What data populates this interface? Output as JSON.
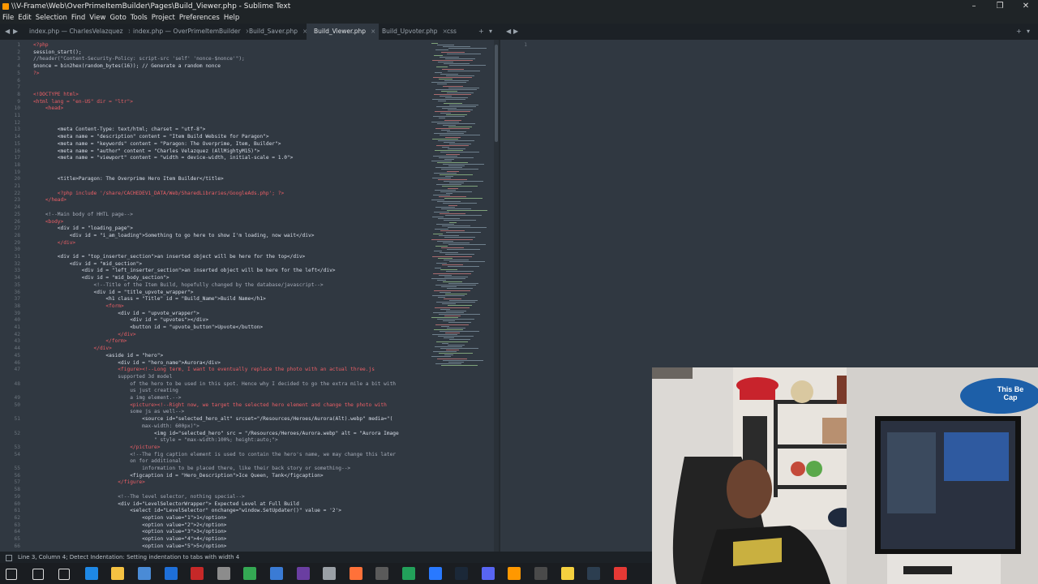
{
  "window": {
    "title": "\\\\V-Frame\\Web\\OverPrimeItemBuilder\\Pages\\Build_Viewer.php - Sublime Text",
    "min": "–",
    "max": "❐",
    "close": "✕"
  },
  "menu": [
    "File",
    "Edit",
    "Selection",
    "Find",
    "View",
    "Goto",
    "Tools",
    "Project",
    "Preferences",
    "Help"
  ],
  "tabs": [
    {
      "label": "index.php — CharlesVelazquez",
      "active": false
    },
    {
      "label": "index.php — OverPrimeItemBuilder",
      "active": false
    },
    {
      "label": "Build_Saver.php",
      "active": false
    },
    {
      "label": "Build_Viewer.php",
      "active": true
    },
    {
      "label": "Build_Upvoter.php",
      "active": false
    },
    {
      "label": "css",
      "active": false
    }
  ],
  "tab_close": "×",
  "nav": {
    "back": "◀",
    "fwd": "▶",
    "add": "+",
    "more": "▾",
    "plus_right": "+",
    "menu_right": "▾"
  },
  "code_lines": [
    {
      "n": "1",
      "t": "<?php"
    },
    {
      "n": "2",
      "t": "session_start();"
    },
    {
      "n": "3",
      "t": "//header(\"Content-Security-Policy: script-src 'self' 'nonce-$nonce'\");"
    },
    {
      "n": "4",
      "t": "$nonce = bin2hex(random_bytes(16)); // Generate a random nonce"
    },
    {
      "n": "5",
      "t": "?>"
    },
    {
      "n": "6",
      "t": ""
    },
    {
      "n": "7",
      "t": ""
    },
    {
      "n": "8",
      "t": "<!DOCTYPE html>"
    },
    {
      "n": "9",
      "t": "<html lang = \"en-US\" dir = \"ltr\">"
    },
    {
      "n": "10",
      "t": "    <head>"
    },
    {
      "n": "11",
      "t": ""
    },
    {
      "n": "12",
      "t": ""
    },
    {
      "n": "13",
      "t": "        <meta Content-Type: text/html; charset = \"utf-8\">"
    },
    {
      "n": "14",
      "t": "        <meta name = \"description\" content = \"Item Build Website for Paragon\">"
    },
    {
      "n": "15",
      "t": "        <meta name = \"keywords\" content = \"Paragon: The Overprime, Item, Builder\">"
    },
    {
      "n": "16",
      "t": "        <meta name = \"author\" content = \"Charles Velazquez (AllMightyM15)\">"
    },
    {
      "n": "17",
      "t": "        <meta name = \"viewport\" content = \"width = device-width, initial-scale = 1.0\">"
    },
    {
      "n": "18",
      "t": ""
    },
    {
      "n": "19",
      "t": ""
    },
    {
      "n": "20",
      "t": "        <title>Paragon: The Overprime Hero Item Builder</title>"
    },
    {
      "n": "21",
      "t": ""
    },
    {
      "n": "22",
      "t": "        <?php include '/share/CACHEDEV1_DATA/Web/SharedLibraries/GoogleAds.php'; ?>"
    },
    {
      "n": "23",
      "t": "    </head>"
    },
    {
      "n": "24",
      "t": ""
    },
    {
      "n": "25",
      "t": "    <!--Main body of HHTL page-->"
    },
    {
      "n": "26",
      "t": "    <body>"
    },
    {
      "n": "27",
      "t": "        <div id = \"loading_page\">"
    },
    {
      "n": "28",
      "t": "            <div id = \"i_am_loading\">Something to go here to show I'm loading, now wait</div>"
    },
    {
      "n": "29",
      "t": "        </div>"
    },
    {
      "n": "30",
      "t": ""
    },
    {
      "n": "31",
      "t": "        <div id = \"top_inserter_section\">an inserted object will be here for the top</div>"
    },
    {
      "n": "32",
      "t": "            <div id = \"mid_section\">"
    },
    {
      "n": "33",
      "t": "                <div id = \"left_inserter_section\">an inserted object will be here for the left</div>"
    },
    {
      "n": "34",
      "t": "                <div id = \"mid_body_section\">"
    },
    {
      "n": "35",
      "t": "                    <!--Title of the Item Build, hopefully changed by the database/javascript-->"
    },
    {
      "n": "36",
      "t": "                    <div id = \"title_upvote_wrapper\">"
    },
    {
      "n": "37",
      "t": "                        <h1 class = \"Title\" id = \"Build_Name\">Build Name</h1>"
    },
    {
      "n": "38",
      "t": "                        <form>"
    },
    {
      "n": "39",
      "t": "                            <div id = \"upvote_wrapper\">"
    },
    {
      "n": "40",
      "t": "                                <div id = \"upvotes\"></div>"
    },
    {
      "n": "41",
      "t": "                                <button id = \"upvote_button\">Upvote</button>"
    },
    {
      "n": "42",
      "t": "                            </div>"
    },
    {
      "n": "43",
      "t": "                        </form>"
    },
    {
      "n": "44",
      "t": "                    </div>"
    },
    {
      "n": "45",
      "t": "                        <aside id = \"hero\">"
    },
    {
      "n": "46",
      "t": "                            <div id = \"hero_name\">Aurora</div>"
    },
    {
      "n": "47",
      "t": "                            <figure><!--Long term, I want to eventually replace the photo with an actual three.js"
    },
    {
      "n": "",
      "t": "                            supported 3d model"
    },
    {
      "n": "48",
      "t": "                                of the hero to be used in this spot. Hence why I decided to go the extra mile a bit with"
    },
    {
      "n": "",
      "t": "                                us just creating"
    },
    {
      "n": "49",
      "t": "                                a img element.-->"
    },
    {
      "n": "50",
      "t": "                                <picture><!--Right now, we target the selected hero element and change the photo with"
    },
    {
      "n": "",
      "t": "                                some js as well-->"
    },
    {
      "n": "51",
      "t": "                                    <source id=\"selected_hero_alt\" srcset=\"/Resources/Heroes/Aurora(Alt).webp\" media=\"("
    },
    {
      "n": "",
      "t": "                                    max-width: 600px)\">"
    },
    {
      "n": "52",
      "t": "                                        <img id=\"selected_hero\" src = \"/Resources/Heroes/Aurora.webp\" alt = \"Aurora Image"
    },
    {
      "n": "",
      "t": "                                        \" style = \"max-width:100%; height:auto;\">"
    },
    {
      "n": "53",
      "t": "                                </picture>"
    },
    {
      "n": "54",
      "t": "                                <!--The fig caption element is used to contain the hero's name, we may change this later"
    },
    {
      "n": "",
      "t": "                                on for additional"
    },
    {
      "n": "55",
      "t": "                                    information to be placed there, like their back story or something-->"
    },
    {
      "n": "56",
      "t": "                                <figcaption id = \"Hero_Description\">Ice Queen, Tank</figcaption>"
    },
    {
      "n": "57",
      "t": "                            </figure>"
    },
    {
      "n": "58",
      "t": ""
    },
    {
      "n": "59",
      "t": "                            <!--The level selector, nothing special-->"
    },
    {
      "n": "60",
      "t": "                            <div id=\"LevelSelectorWrapper\"> Expected Level at Full Build"
    },
    {
      "n": "61",
      "t": "                                <select id=\"LevelSelector\" onchange=\"window.SetUpdater()\" value = '2'>"
    },
    {
      "n": "62",
      "t": "                                    <option value=\"1\">1</option>"
    },
    {
      "n": "63",
      "t": "                                    <option value=\"2\">2</option>"
    },
    {
      "n": "64",
      "t": "                                    <option value=\"3\">3</option>"
    },
    {
      "n": "65",
      "t": "                                    <option value=\"4\">4</option>"
    },
    {
      "n": "66",
      "t": "                                    <option value=\"5\">5</option>"
    }
  ],
  "pane2_line": "1",
  "status": "Line 3, Column 4; Detect Indentation: Setting indentation to tabs with width 4",
  "taskbar_icons": [
    "windows-start",
    "search",
    "task-view",
    "edge",
    "file-explorer",
    "store",
    "mail",
    "app-red",
    "settings",
    "chrome",
    "app-a",
    "app-vs",
    "app-box",
    "firefox",
    "app-obs",
    "app-green",
    "app-blue",
    "app-steam",
    "app-discord",
    "sublime",
    "app-x",
    "app-note",
    "app-terminal",
    "app-red2"
  ],
  "webcam": {
    "sign": "This Be Cap",
    "hat": "Cap"
  }
}
